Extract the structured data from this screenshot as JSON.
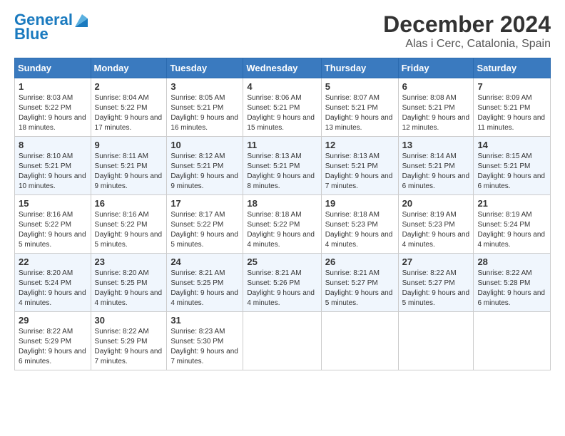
{
  "logo": {
    "line1": "General",
    "line2": "Blue"
  },
  "title": "December 2024",
  "subtitle": "Alas i Cerc, Catalonia, Spain",
  "days_of_week": [
    "Sunday",
    "Monday",
    "Tuesday",
    "Wednesday",
    "Thursday",
    "Friday",
    "Saturday"
  ],
  "weeks": [
    [
      {
        "day": "1",
        "sunrise": "8:03 AM",
        "sunset": "5:22 PM",
        "daylight_hours": "9",
        "daylight_minutes": "18"
      },
      {
        "day": "2",
        "sunrise": "8:04 AM",
        "sunset": "5:22 PM",
        "daylight_hours": "9",
        "daylight_minutes": "17"
      },
      {
        "day": "3",
        "sunrise": "8:05 AM",
        "sunset": "5:21 PM",
        "daylight_hours": "9",
        "daylight_minutes": "16"
      },
      {
        "day": "4",
        "sunrise": "8:06 AM",
        "sunset": "5:21 PM",
        "daylight_hours": "9",
        "daylight_minutes": "15"
      },
      {
        "day": "5",
        "sunrise": "8:07 AM",
        "sunset": "5:21 PM",
        "daylight_hours": "9",
        "daylight_minutes": "13"
      },
      {
        "day": "6",
        "sunrise": "8:08 AM",
        "sunset": "5:21 PM",
        "daylight_hours": "9",
        "daylight_minutes": "12"
      },
      {
        "day": "7",
        "sunrise": "8:09 AM",
        "sunset": "5:21 PM",
        "daylight_hours": "9",
        "daylight_minutes": "11"
      }
    ],
    [
      {
        "day": "8",
        "sunrise": "8:10 AM",
        "sunset": "5:21 PM",
        "daylight_hours": "9",
        "daylight_minutes": "10"
      },
      {
        "day": "9",
        "sunrise": "8:11 AM",
        "sunset": "5:21 PM",
        "daylight_hours": "9",
        "daylight_minutes": "9"
      },
      {
        "day": "10",
        "sunrise": "8:12 AM",
        "sunset": "5:21 PM",
        "daylight_hours": "9",
        "daylight_minutes": "9"
      },
      {
        "day": "11",
        "sunrise": "8:13 AM",
        "sunset": "5:21 PM",
        "daylight_hours": "9",
        "daylight_minutes": "8"
      },
      {
        "day": "12",
        "sunrise": "8:13 AM",
        "sunset": "5:21 PM",
        "daylight_hours": "9",
        "daylight_minutes": "7"
      },
      {
        "day": "13",
        "sunrise": "8:14 AM",
        "sunset": "5:21 PM",
        "daylight_hours": "9",
        "daylight_minutes": "6"
      },
      {
        "day": "14",
        "sunrise": "8:15 AM",
        "sunset": "5:21 PM",
        "daylight_hours": "9",
        "daylight_minutes": "6"
      }
    ],
    [
      {
        "day": "15",
        "sunrise": "8:16 AM",
        "sunset": "5:22 PM",
        "daylight_hours": "9",
        "daylight_minutes": "5"
      },
      {
        "day": "16",
        "sunrise": "8:16 AM",
        "sunset": "5:22 PM",
        "daylight_hours": "9",
        "daylight_minutes": "5"
      },
      {
        "day": "17",
        "sunrise": "8:17 AM",
        "sunset": "5:22 PM",
        "daylight_hours": "9",
        "daylight_minutes": "5"
      },
      {
        "day": "18",
        "sunrise": "8:18 AM",
        "sunset": "5:22 PM",
        "daylight_hours": "9",
        "daylight_minutes": "4"
      },
      {
        "day": "19",
        "sunrise": "8:18 AM",
        "sunset": "5:23 PM",
        "daylight_hours": "9",
        "daylight_minutes": "4"
      },
      {
        "day": "20",
        "sunrise": "8:19 AM",
        "sunset": "5:23 PM",
        "daylight_hours": "9",
        "daylight_minutes": "4"
      },
      {
        "day": "21",
        "sunrise": "8:19 AM",
        "sunset": "5:24 PM",
        "daylight_hours": "9",
        "daylight_minutes": "4"
      }
    ],
    [
      {
        "day": "22",
        "sunrise": "8:20 AM",
        "sunset": "5:24 PM",
        "daylight_hours": "9",
        "daylight_minutes": "4"
      },
      {
        "day": "23",
        "sunrise": "8:20 AM",
        "sunset": "5:25 PM",
        "daylight_hours": "9",
        "daylight_minutes": "4"
      },
      {
        "day": "24",
        "sunrise": "8:21 AM",
        "sunset": "5:25 PM",
        "daylight_hours": "9",
        "daylight_minutes": "4"
      },
      {
        "day": "25",
        "sunrise": "8:21 AM",
        "sunset": "5:26 PM",
        "daylight_hours": "9",
        "daylight_minutes": "4"
      },
      {
        "day": "26",
        "sunrise": "8:21 AM",
        "sunset": "5:27 PM",
        "daylight_hours": "9",
        "daylight_minutes": "5"
      },
      {
        "day": "27",
        "sunrise": "8:22 AM",
        "sunset": "5:27 PM",
        "daylight_hours": "9",
        "daylight_minutes": "5"
      },
      {
        "day": "28",
        "sunrise": "8:22 AM",
        "sunset": "5:28 PM",
        "daylight_hours": "9",
        "daylight_minutes": "6"
      }
    ],
    [
      {
        "day": "29",
        "sunrise": "8:22 AM",
        "sunset": "5:29 PM",
        "daylight_hours": "9",
        "daylight_minutes": "6"
      },
      {
        "day": "30",
        "sunrise": "8:22 AM",
        "sunset": "5:29 PM",
        "daylight_hours": "9",
        "daylight_minutes": "7"
      },
      {
        "day": "31",
        "sunrise": "8:23 AM",
        "sunset": "5:30 PM",
        "daylight_hours": "9",
        "daylight_minutes": "7"
      },
      null,
      null,
      null,
      null
    ]
  ],
  "labels": {
    "sunrise": "Sunrise:",
    "sunset": "Sunset:",
    "daylight": "Daylight:",
    "hours_suffix": "hours",
    "and": "and",
    "minutes_suffix": "minutes."
  }
}
